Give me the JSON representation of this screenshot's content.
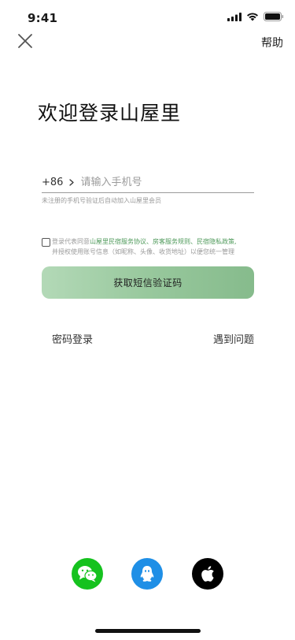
{
  "status_bar": {
    "time": "9:41"
  },
  "nav": {
    "help_label": "帮助"
  },
  "title": "欢迎登录山屋里",
  "phone": {
    "country_code": "+86",
    "placeholder": "请输入手机号",
    "hint": "未注册的手机号验证后自动加入山屋里会员"
  },
  "agreement": {
    "prefix": "登录代表同意",
    "link1": "山屋里民宿服务协议、",
    "link2": "房客服务规则、",
    "link3": "民宿隐私政策,",
    "line2": "并授权使用账号信息（如昵称、头像、收货地址）以便您统一管理"
  },
  "buttons": {
    "sms_code": "获取短信验证码",
    "password_login": "密码登录",
    "problem": "遇到问题"
  },
  "social": {
    "icons": [
      "wechat-icon",
      "qq-icon",
      "apple-icon"
    ],
    "colors": {
      "wechat": "#15c21e",
      "qq": "#1f8fe6",
      "apple": "#000000"
    }
  },
  "colors": {
    "accent": "#4f9a5b",
    "button_gradient_start": "#b3d9b7",
    "button_gradient_end": "#86bb8c"
  }
}
